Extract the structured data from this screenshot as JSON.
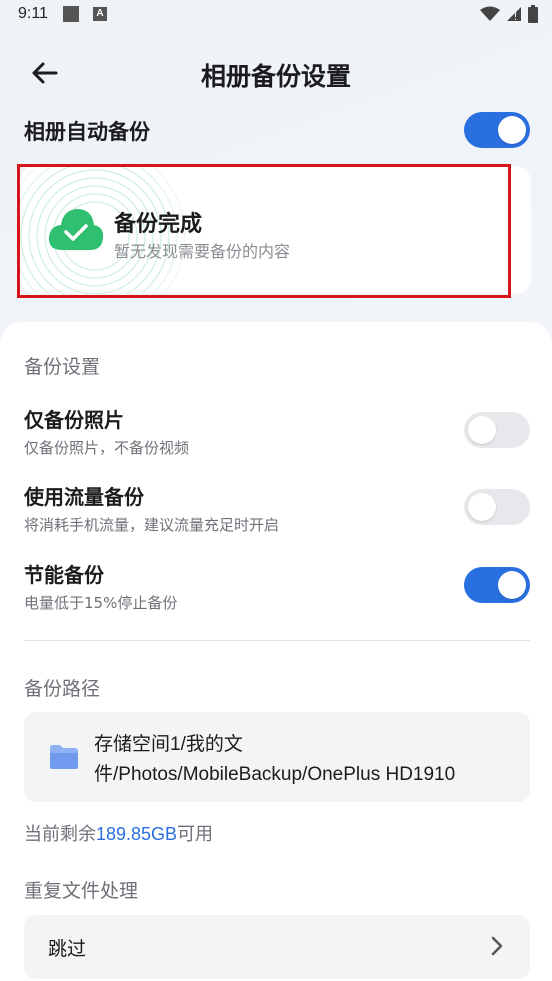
{
  "status_bar": {
    "time": "9:11",
    "notif_letter": "A"
  },
  "header": {
    "title": "相册备份设置"
  },
  "auto_backup": {
    "label": "相册自动备份",
    "enabled": true
  },
  "backup_status": {
    "title": "备份完成",
    "subtitle": "暂无发现需要备份的内容"
  },
  "settings": {
    "section_label": "备份设置",
    "items": [
      {
        "title": "仅备份照片",
        "desc": "仅备份照片，不备份视频",
        "enabled": false
      },
      {
        "title": "使用流量备份",
        "desc": "将消耗手机流量，建议流量充足时开启",
        "enabled": false
      },
      {
        "title": "节能备份",
        "desc": "电量低于15%停止备份",
        "enabled": true
      }
    ]
  },
  "backup_path": {
    "section_label": "备份路径",
    "path": "存储空间1/我的文件/Photos/MobileBackup/OnePlus HD1910",
    "remaining_prefix": "当前剩余",
    "remaining_value": "189.85GB",
    "remaining_suffix": "可用"
  },
  "duplicate": {
    "section_label": "重复文件处理",
    "value": "跳过"
  },
  "colors": {
    "accent": "#2a6fe0",
    "success": "#2fbf71",
    "highlight_border": "#d6141a",
    "toggle_off": "#e6e8ec"
  },
  "icons": [
    "back-arrow-icon",
    "cloud-check-icon",
    "folder-icon",
    "chevron-right-icon",
    "wifi-icon",
    "signal-icon",
    "battery-icon"
  ]
}
